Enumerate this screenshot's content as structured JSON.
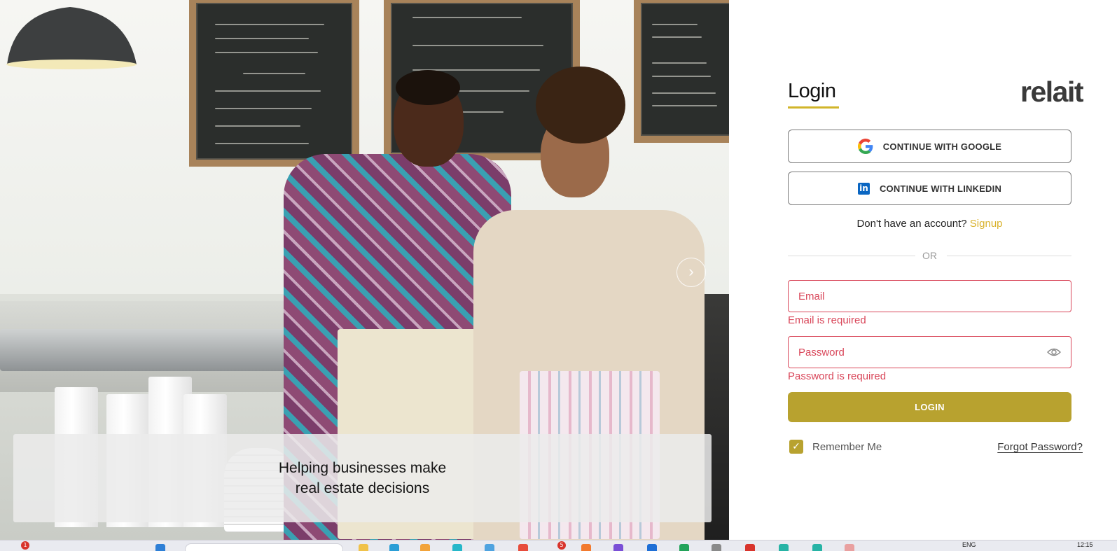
{
  "hero": {
    "caption": "Helping businesses make real estate decisions",
    "next_icon": "chevron-right-icon"
  },
  "login": {
    "title": "Login",
    "brand": "relait",
    "google_button": "CONTINUE WITH GOOGLE",
    "linkedin_button": "CONTINUE WITH LINKEDIN",
    "signup_prompt": "Don't have an account?",
    "signup_link": "Signup",
    "divider": "OR",
    "email_placeholder": "Email",
    "email_error": "Email is required",
    "password_placeholder": "Password",
    "password_error": "Password is required",
    "submit": "LOGIN",
    "remember_me": "Remember Me",
    "remember_checked": true,
    "forgot": "Forgot Password?"
  },
  "taskbar": {
    "lang": "ENG",
    "time": "12:15",
    "badges": [
      "1",
      "5"
    ]
  },
  "colors": {
    "accent": "#b8a22f",
    "underline": "#d1b52a",
    "error": "#d9475a",
    "link": "#d9b22b"
  }
}
